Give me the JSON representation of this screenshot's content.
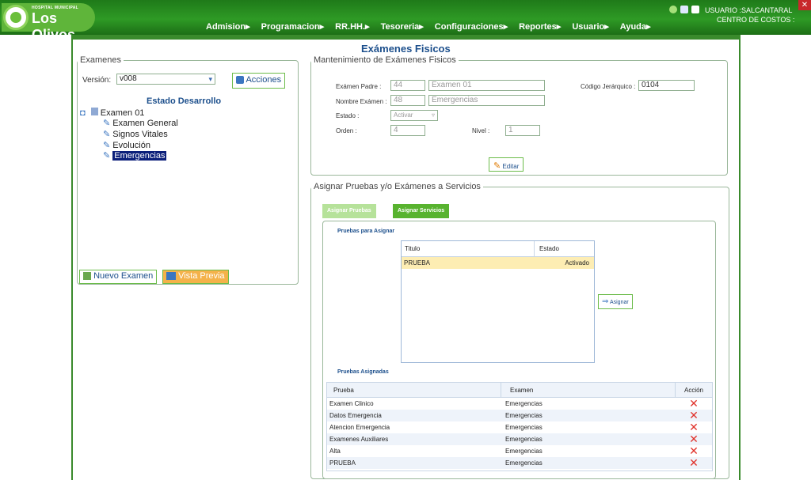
{
  "logo": {
    "small": "HOSPITAL MUNICIPAL",
    "big": "Los Olivos"
  },
  "menu": [
    "Admision▸",
    "Programacion▸",
    "RR.HH.▸",
    "Tesoreria▸",
    "Configuraciones▸",
    "Reportes▸",
    "Usuario▸",
    "Ayuda▸"
  ],
  "user": "USUARIO :SALCANTARAL",
  "cost_center": "CENTRO DE COSTOS :",
  "page_title": "Exámenes Fisicos",
  "exams": {
    "legend": "Examenes",
    "version_label": "Versión:",
    "version_value": "v008",
    "acciones": "Acciones",
    "estado": "Estado Desarrollo",
    "tree_root": "Examen 01",
    "tree_children": [
      "Examen General",
      "Signos Vitales",
      "Evolución",
      "Emergencias"
    ],
    "nuevo": "Nuevo Examen",
    "vista": "Vista Previa"
  },
  "mant": {
    "legend": "Mantenimiento de Exámenes Fisicos",
    "padre_label": "Exámen Padre :",
    "padre_id": "44",
    "padre_name": "Examen 01",
    "codigo_label": "Código Jerárquico :",
    "codigo": "0104",
    "nombre_label": "Nombre Exámen :",
    "nombre_id": "48",
    "nombre": "Emergencias",
    "estado_label": "Estado :",
    "estado": "Activar",
    "orden_label": "Orden :",
    "orden": "4",
    "nivel_label": "Nivel :",
    "nivel": "1",
    "editar": "Editar"
  },
  "asig": {
    "legend": "Asignar Pruebas y/o Exámenes a Servicios",
    "tab1": "Asignar Pruebas",
    "tab2": "Asignar Servicios",
    "para_asignar": "Pruebas para Asignar",
    "grid1_headers": [
      "Titulo",
      "Estado"
    ],
    "grid1_rows": [
      {
        "titulo": "PRUEBA",
        "estado": "Activado"
      }
    ],
    "asignar": "Asignar",
    "asignadas": "Pruebas Asignadas",
    "grid2_headers": [
      "Prueba",
      "Examen",
      "Acción"
    ],
    "grid2_rows": [
      {
        "prueba": "Examen Clinico",
        "examen": "Emergencias",
        "accion": "✕"
      },
      {
        "prueba": "Datos Emergencia",
        "examen": "Emergencias",
        "accion": "✕"
      },
      {
        "prueba": "Atencion Emergencia",
        "examen": "Emergencias",
        "accion": "✕"
      },
      {
        "prueba": "Examenes Auxiliares",
        "examen": "Emergencias",
        "accion": "✕"
      },
      {
        "prueba": "Alta",
        "examen": "Emergencias",
        "accion": "✕"
      },
      {
        "prueba": "PRUEBA",
        "examen": "Emergencias",
        "accion": "✕"
      }
    ]
  }
}
